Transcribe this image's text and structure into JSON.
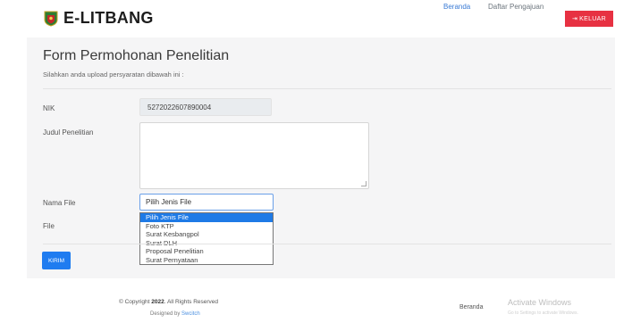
{
  "header": {
    "brand": "E-LITBANG",
    "nav": {
      "home": "Beranda",
      "submissions": "Daftar Pengajuan",
      "logout": "KELUAR"
    },
    "colors": {
      "logout_bg": "#e73142",
      "active_link": "#3a7bd5"
    }
  },
  "form": {
    "title": "Form Permohonan Penelitian",
    "subtitle": "Silahkan anda upload persyaratan dibawah ini :",
    "nik_label": "NIK",
    "nik_value": "5272022607890004",
    "judul_label": "Judul Penelitian",
    "judul_value": "",
    "nama_file_label": "Nama File",
    "file_label": "File",
    "select": {
      "selected": "Pilih Jenis File",
      "options": [
        "Pilih Jenis File",
        "Foto KTP",
        "Surat Kesbangpol",
        "Surat DLH",
        "Proposal Penelitian",
        "Surat Pernyataan"
      ]
    },
    "submit_label": "KIRIM",
    "colors": {
      "submit_bg": "#1f7cf0",
      "option_highlight": "#1e7ae6"
    }
  },
  "footer": {
    "copyright_prefix": "© Copyright ",
    "year": "2022",
    "copyright_suffix": ". All Rights Reserved",
    "designed_prefix": "Designed by ",
    "designed_by": "Swcitch",
    "link_home": "Beranda"
  },
  "os_watermark": {
    "title": "Activate Windows",
    "subtitle": "Go to Settings to activate Windows."
  }
}
